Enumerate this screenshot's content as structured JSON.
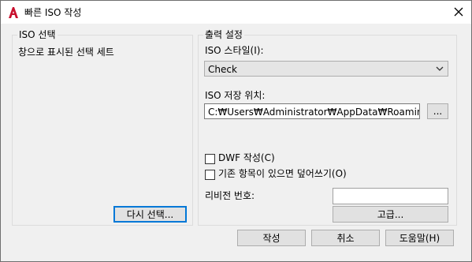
{
  "window": {
    "title": "빠른 ISO 작성",
    "icon": "autocad-a-icon",
    "close_glyph": "✕"
  },
  "left_group": {
    "label": "ISO 선택",
    "selection_text": "창으로 표시된 선택 세트",
    "reselect_button": "다시 선택..."
  },
  "right_group": {
    "label": "출력 설정",
    "style_label": "ISO 스타일(I):",
    "style_value": "Check",
    "location_label": "ISO 저장 위치:",
    "location_value": "C:₩Users₩Administrator₩AppData₩Roaming₩",
    "browse_button": "...",
    "dwf_checkbox_label": "DWF 작성(C)",
    "dwf_checked": false,
    "overwrite_checkbox_label": "기존 항목이 있으면 덮어쓰기(O)",
    "overwrite_checked": false,
    "revision_label": "리비전 번호:",
    "revision_value": "",
    "advanced_button": "고급..."
  },
  "footer": {
    "create_button": "작성",
    "cancel_button": "취소",
    "help_button": "도움말(H)"
  },
  "colors": {
    "dialog_bg": "#f0f0f0",
    "focus_border": "#0078d7",
    "app_icon_red": "#c8102e"
  }
}
